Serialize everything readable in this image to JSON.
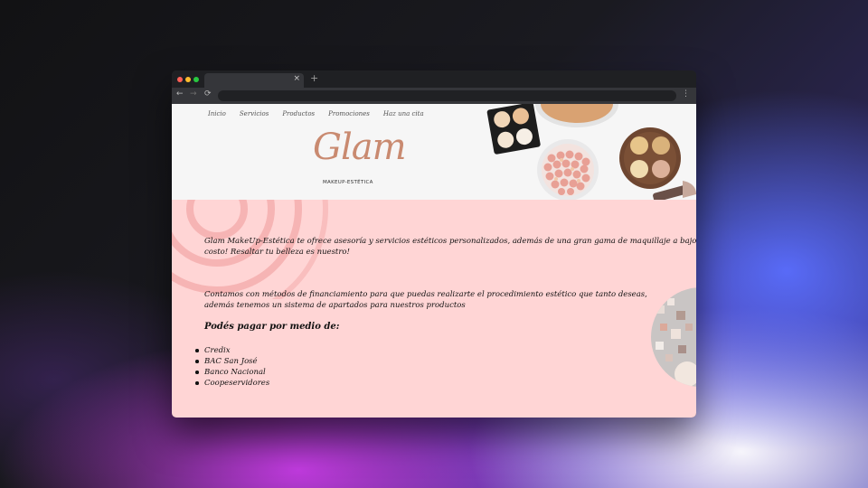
{
  "browser": {
    "tab_close": "×",
    "new_tab": "+",
    "back_icon": "←",
    "forward_icon": "→",
    "reload_icon": "⟳",
    "menu_icon": "⋮",
    "address": ""
  },
  "site": {
    "nav": [
      "Inicio",
      "Servicios",
      "Productos",
      "Promociones",
      "Haz una cita"
    ],
    "logo": "Glam",
    "tagline": "MAKEUP-ESTÉTICA",
    "intro": "Glam MakeUp-Estética te ofrece asesoría y servicios estéticos personalizados, además de una gran gama de maquillaje a bajo costo! Resaltar tu belleza es nuestro!",
    "financing": "Contamos con métodos de financiamiento para que puedas realizarte el procedimiento estético que tanto deseas, además tenemos un sistema de apartados para nuestros productos",
    "payment_title": "Podés pagar por medio de:",
    "payment_methods": [
      "Credix",
      "BAC San José",
      "Banco Nacional",
      "Coopeservidores"
    ]
  },
  "colors": {
    "page_background": "#ffd5d5",
    "hero_background": "#f6f6f6",
    "logo": "#c98a70"
  }
}
